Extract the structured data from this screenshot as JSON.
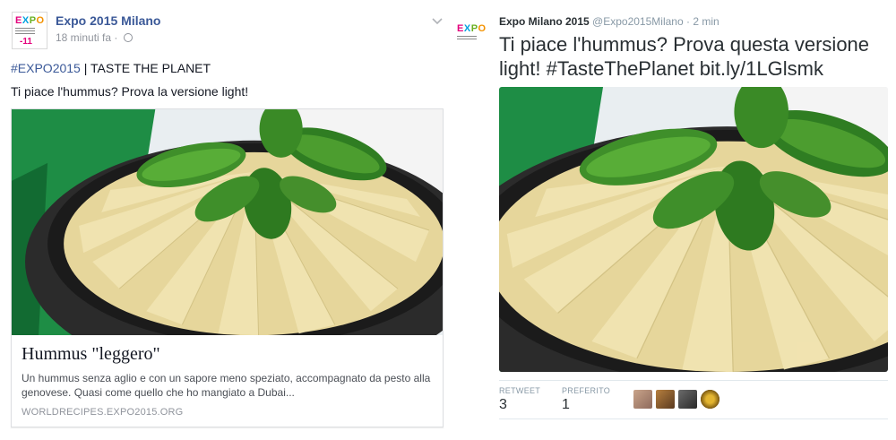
{
  "facebook": {
    "logo": {
      "count": "-11",
      "word": "EXPO"
    },
    "page_name": "Expo 2015 Milano",
    "time": "18 minuti fa ·",
    "post": {
      "hashtag": "#EXPO2015",
      "line1_rest": " | TASTE THE PLANET",
      "line2": "Ti piace l'hummus? Prova la versione light!"
    },
    "attachment": {
      "image": "hummus-bowl-photo",
      "title": "Hummus \"leggero\"",
      "description": "Un hummus senza aglio e con un sapore meno speziato, accompagnato da pesto alla genovese. Quasi come quello che ho mangiato a Dubai...",
      "domain": "WORLDRECIPES.EXPO2015.ORG"
    },
    "icons": {
      "privacy": "globe-icon",
      "menu": "chevron-down-icon"
    },
    "colors": {
      "link": "#3b5998",
      "meta": "#90949c"
    }
  },
  "twitter": {
    "logo": {
      "word": "EXPO"
    },
    "name": "Expo Milano 2015",
    "handle": "@Expo2015Milano",
    "dot": "·",
    "time": "2 min",
    "text": "Ti piace l'hummus? Prova questa versione light! #TasteThePlanet bit.ly/1LGlsmk",
    "image": "hummus-bowl-photo",
    "stats": [
      {
        "label": "RETWEET",
        "value": "3"
      },
      {
        "label": "PREFERITO",
        "value": "1"
      }
    ],
    "avatars": [
      "avatar-1",
      "avatar-2",
      "avatar-3",
      "avatar-4"
    ]
  }
}
